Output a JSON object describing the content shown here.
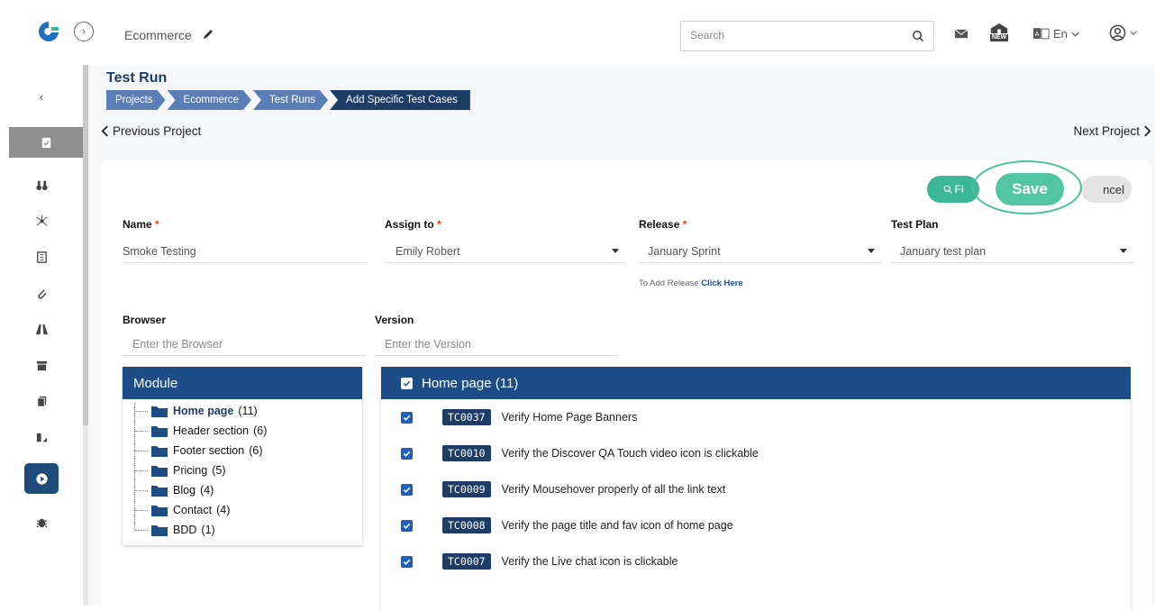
{
  "header": {
    "project_name": "Ecommerce",
    "search_placeholder": "Search",
    "language": "En",
    "new_badge": "NEW"
  },
  "page": {
    "title": "Test Run",
    "breadcrumbs": [
      "Projects",
      "Ecommerce",
      "Test Runs",
      "Add Specific Test Cases"
    ],
    "prev_label": "Previous Project",
    "next_label": "Next Project"
  },
  "actions": {
    "find_label": "Fi",
    "save_label": "Save",
    "cancel_label": "ncel"
  },
  "form": {
    "name": {
      "label": "Name",
      "value": "Smoke Testing"
    },
    "assign": {
      "label": "Assign to",
      "value": "Emily Robert"
    },
    "release": {
      "label": "Release",
      "value": "January Sprint",
      "helper": "To Add Release",
      "helper_link": "Click Here"
    },
    "test_plan": {
      "label": "Test Plan",
      "value": "January test plan"
    },
    "browser": {
      "label": "Browser",
      "placeholder": "Enter the Browser"
    },
    "version": {
      "label": "Version",
      "placeholder": "Enter the Version"
    },
    "required_mark": "*"
  },
  "module": {
    "title": "Module",
    "items": [
      {
        "name": "Home page",
        "count": "(11)"
      },
      {
        "name": "Header section",
        "count": "(6)"
      },
      {
        "name": "Footer section",
        "count": "(6)"
      },
      {
        "name": "Pricing",
        "count": "(5)"
      },
      {
        "name": "Blog",
        "count": "(4)"
      },
      {
        "name": "Contact",
        "count": "(4)"
      },
      {
        "name": "BDD",
        "count": "(1)"
      }
    ]
  },
  "testcases": {
    "title": "Home page",
    "count": "(11)",
    "rows": [
      {
        "id": "TC0037",
        "title": "Verify Home Page Banners"
      },
      {
        "id": "TC0010",
        "title": "Verify the Discover QA Touch video icon is clickable"
      },
      {
        "id": "TC0009",
        "title": "Verify Mousehover properly of all the link text"
      },
      {
        "id": "TC0008",
        "title": "Verify the page title and fav icon of home page"
      },
      {
        "id": "TC0007",
        "title": "Verify the Live chat icon is clickable"
      }
    ]
  },
  "colors": {
    "primary": "#1e4d86",
    "accent": "#52c6a3",
    "breadcrumb": "#5b7fb5",
    "required": "#e53935"
  }
}
